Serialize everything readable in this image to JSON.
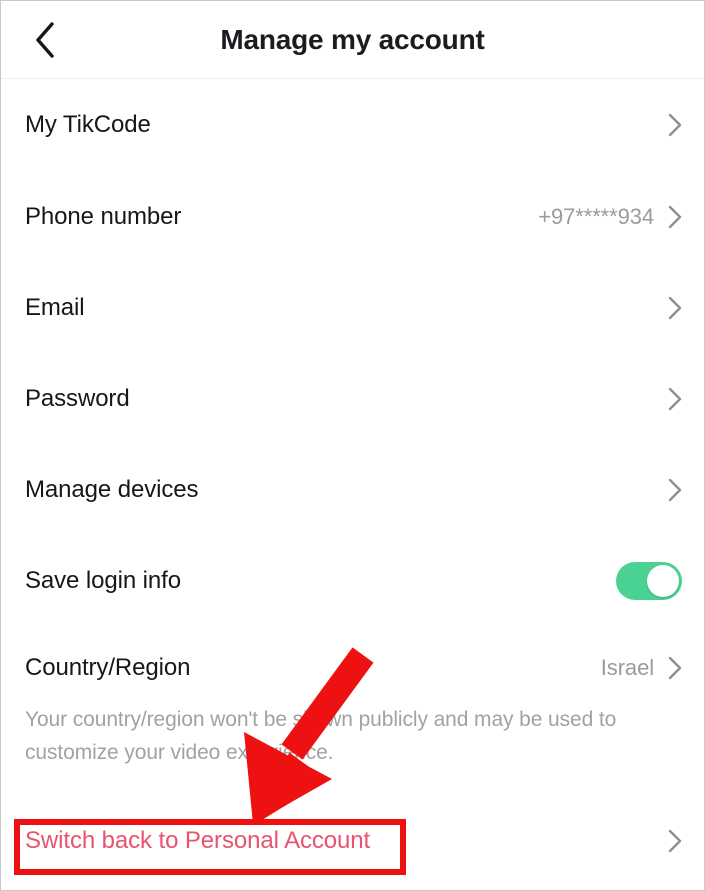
{
  "header": {
    "title": "Manage my account",
    "back_icon": "chevron-left-icon"
  },
  "settings": {
    "rows": [
      {
        "label": "My TikCode",
        "value": "",
        "accessory": "chevron-right-icon"
      },
      {
        "label": "Phone number",
        "value": "+97*****934",
        "accessory": "chevron-right-icon"
      },
      {
        "label": "Email",
        "value": "",
        "accessory": "chevron-right-icon"
      },
      {
        "label": "Password",
        "value": "",
        "accessory": "chevron-right-icon"
      },
      {
        "label": "Manage devices",
        "value": "",
        "accessory": "chevron-right-icon"
      },
      {
        "label": "Save login info",
        "value": "",
        "accessory": "toggle-switch"
      },
      {
        "label": "Country/Region",
        "value": "Israel",
        "accessory": "chevron-right-icon"
      }
    ],
    "save_login_toggle": {
      "state": "on",
      "on_color": "#4ad295"
    },
    "country_description": "Your country/region won't be shown publicly and may be used to customize your video experience.",
    "switch_account": {
      "label": "Switch back to Personal Account",
      "accessory": "chevron-right-icon",
      "color": "#e8536e"
    }
  },
  "annotations": {
    "highlight_color": "#ee1111",
    "arrow": "down-left-arrow",
    "box": "highlight-rectangle"
  }
}
